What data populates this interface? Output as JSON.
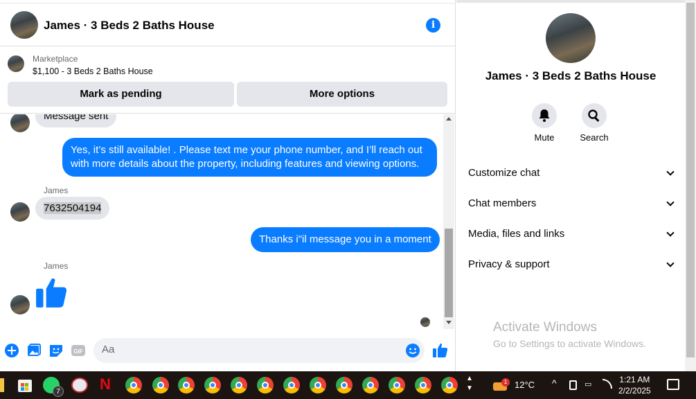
{
  "header": {
    "title": "James · 3 Beds 2 Baths House"
  },
  "listing": {
    "category": "Marketplace",
    "title": "$1,100 - 3 Beds 2 Baths House",
    "pending_label": "Mark as pending",
    "more_label": "More options"
  },
  "thread": {
    "messages": [
      {
        "direction": "in",
        "text": "Message sent"
      },
      {
        "direction": "out",
        "text": "Yes, it’s still available! . Please text me your phone number, and I’ll reach out with more details about the property, including features and viewing options."
      },
      {
        "direction": "in",
        "sender": "James",
        "text": "7632504194"
      },
      {
        "direction": "out",
        "text": "Thanks i\"il message you in a moment"
      },
      {
        "direction": "in",
        "sender": "James",
        "icon": "thumbs-up-icon"
      }
    ]
  },
  "composer": {
    "placeholder": "Aa"
  },
  "panel": {
    "title": "James · 3 Beds 2 Baths House",
    "actions": [
      {
        "label": "Mute",
        "icon": "bell-icon"
      },
      {
        "label": "Search",
        "icon": "search-icon"
      }
    ],
    "sections": [
      "Customize chat",
      "Chat members",
      "Media, files and links",
      "Privacy & support"
    ]
  },
  "watermark": {
    "line1": "Activate Windows",
    "line2": "Go to Settings to activate Windows."
  },
  "taskbar": {
    "whatsapp_badge": "7",
    "weather_badge": "1",
    "temperature": "12°C",
    "time": "1:21 AM",
    "date": "2/2/2025"
  },
  "colors": {
    "accent": "#0a7cff",
    "bubble_in": "#e4e6eb",
    "taskbar": "#1c1410"
  }
}
